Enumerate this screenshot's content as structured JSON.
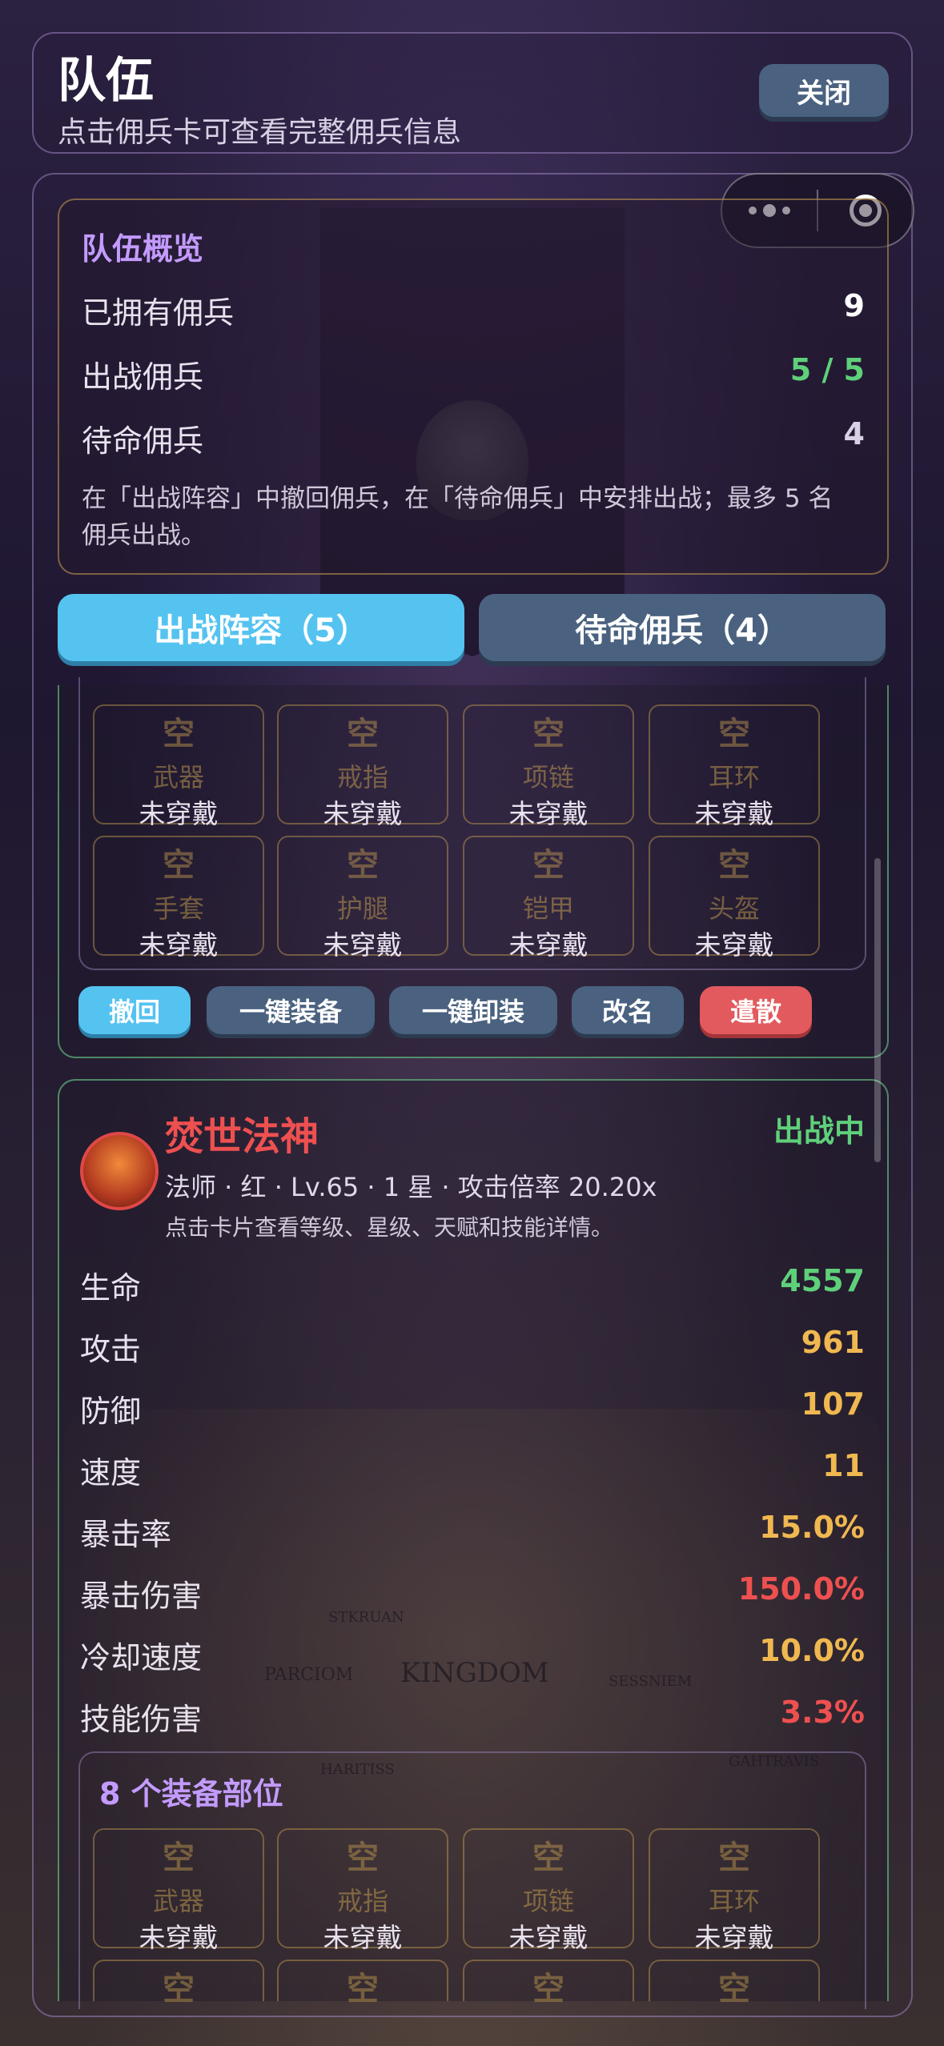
{
  "header": {
    "title": "队伍",
    "subtitle": "点击佣兵卡可查看完整佣兵信息",
    "close_label": "关闭"
  },
  "capsule": {
    "more_icon": "more-dots-icon",
    "close_icon": "target-circle-icon"
  },
  "overview": {
    "title": "队伍概览",
    "rows": [
      {
        "label": "已拥有佣兵",
        "value": "9",
        "color": "#ffffff"
      },
      {
        "label": "出战佣兵",
        "value": "5 / 5",
        "color": "#5fd07a"
      },
      {
        "label": "待命佣兵",
        "value": "4",
        "color": "#d8d0e4"
      }
    ],
    "note": "在「出战阵容」中撤回佣兵，在「待命佣兵」中安排出战；最多 5 名佣兵出战。"
  },
  "tabs": [
    {
      "label": "出战阵容（5）",
      "active": true
    },
    {
      "label": "待命佣兵（4）",
      "active": false
    }
  ],
  "card1": {
    "slots": [
      {
        "icon": "空",
        "name": "武器",
        "status": "未穿戴"
      },
      {
        "icon": "空",
        "name": "戒指",
        "status": "未穿戴"
      },
      {
        "icon": "空",
        "name": "项链",
        "status": "未穿戴"
      },
      {
        "icon": "空",
        "name": "耳环",
        "status": "未穿戴"
      },
      {
        "icon": "空",
        "name": "手套",
        "status": "未穿戴"
      },
      {
        "icon": "空",
        "name": "护腿",
        "status": "未穿戴"
      },
      {
        "icon": "空",
        "name": "铠甲",
        "status": "未穿戴"
      },
      {
        "icon": "空",
        "name": "头盔",
        "status": "未穿戴"
      }
    ],
    "actions": {
      "recall": "撤回",
      "equip_all": "一键装备",
      "unequip_all": "一键卸装",
      "rename": "改名",
      "dismiss": "遣散"
    }
  },
  "card2": {
    "name": "焚世法神",
    "status": "出战中",
    "meta": "法师 · 红 · Lv.65 · 1 星 · 攻击倍率 20.20x",
    "tip": "点击卡片查看等级、星级、天赋和技能详情。",
    "stats": [
      {
        "label": "生命",
        "value": "4557",
        "color": "#5fd07a"
      },
      {
        "label": "攻击",
        "value": "961",
        "color": "#f0b850"
      },
      {
        "label": "防御",
        "value": "107",
        "color": "#f0b850"
      },
      {
        "label": "速度",
        "value": "11",
        "color": "#f0b850"
      },
      {
        "label": "暴击率",
        "value": "15.0%",
        "color": "#f0b850"
      },
      {
        "label": "暴击伤害",
        "value": "150.0%",
        "color": "#ee5050"
      },
      {
        "label": "冷却速度",
        "value": "10.0%",
        "color": "#f0b850"
      },
      {
        "label": "技能伤害",
        "value": "3.3%",
        "color": "#ee5050"
      }
    ],
    "equip_title": "8 个装备部位",
    "slots": [
      {
        "icon": "空",
        "name": "武器",
        "status": "未穿戴"
      },
      {
        "icon": "空",
        "name": "戒指",
        "status": "未穿戴"
      },
      {
        "icon": "空",
        "name": "项链",
        "status": "未穿戴"
      },
      {
        "icon": "空",
        "name": "耳环",
        "status": "未穿戴"
      },
      {
        "icon": "空"
      },
      {
        "icon": "空"
      },
      {
        "icon": "空"
      },
      {
        "icon": "空"
      }
    ]
  },
  "background_map": {
    "labels": [
      "KINGDOM",
      "STKRUAN",
      "PARCIOM",
      "SESSNIEM",
      "HARITISS",
      "GAHTRAVIS"
    ]
  }
}
